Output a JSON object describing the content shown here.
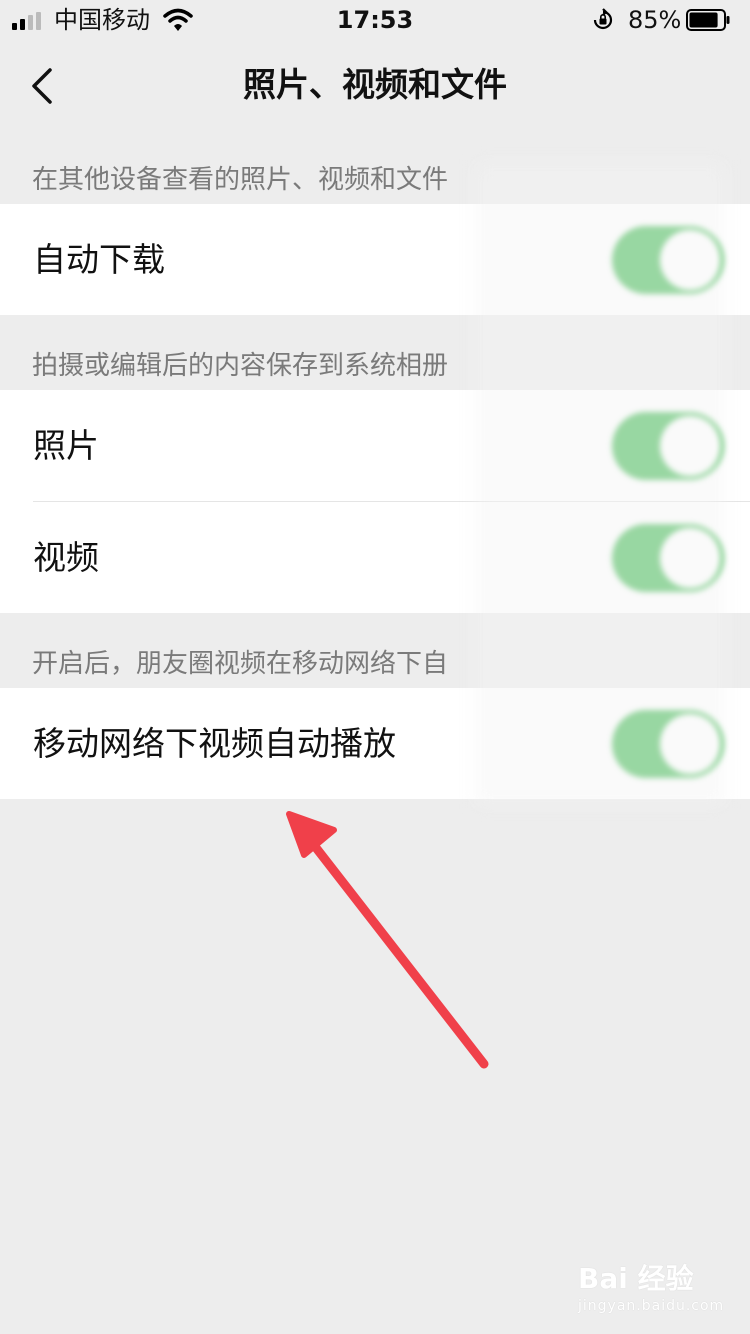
{
  "status_bar": {
    "carrier": "中国移动",
    "time": "17:53",
    "battery_percent": "85%",
    "battery_level": 0.85
  },
  "nav": {
    "title": "照片、视频和文件",
    "back_icon": "chevron-left-icon"
  },
  "sections": [
    {
      "header": "在其他设备查看的照片、视频和文件",
      "rows": [
        {
          "label": "自动下载",
          "toggle_on": true
        }
      ]
    },
    {
      "header": "拍摄或编辑后的内容保存到系统相册",
      "rows": [
        {
          "label": "照片",
          "toggle_on": true
        },
        {
          "label": "视频",
          "toggle_on": true
        }
      ]
    },
    {
      "header": "开启后，朋友圈视频在移动网络下自",
      "rows": [
        {
          "label": "移动网络下视频自动播放",
          "toggle_on": true
        }
      ]
    }
  ],
  "colors": {
    "accent_green": "#4ebf5f",
    "background": "#ededed",
    "arrow_red": "#f0404a"
  },
  "watermark": {
    "main": "Bai 经验",
    "sub": "jingyan.baidu.com"
  }
}
